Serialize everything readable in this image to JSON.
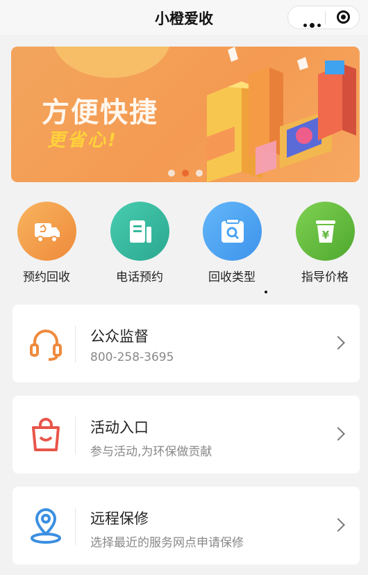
{
  "header": {
    "title": "小橙爱收"
  },
  "banner": {
    "headline": "方便快捷",
    "subline": "更省心!",
    "slides": 3,
    "active_slide": 2
  },
  "menu": {
    "items": [
      {
        "label": "预约回收",
        "icon": "truck-icon",
        "color": "#f29a46"
      },
      {
        "label": "电话预约",
        "icon": "phone-document-icon",
        "color": "#35b89d"
      },
      {
        "label": "回收类型",
        "icon": "search-box-icon",
        "color": "#4aa3f2"
      },
      {
        "label": "指导价格",
        "icon": "yen-bin-icon",
        "color": "#5fb83b"
      }
    ]
  },
  "cards": [
    {
      "title": "公众监督",
      "subtitle": "800-258-3695",
      "icon": "headset-icon",
      "icon_color": "#ef8a3c"
    },
    {
      "title": "活动入口",
      "subtitle": "参与活动,为环保做贡献",
      "icon": "shopping-bag-icon",
      "icon_color": "#e8554a"
    },
    {
      "title": "远程保修",
      "subtitle": "选择最近的服务网点申请保修",
      "icon": "location-pin-icon",
      "icon_color": "#3b8fe0"
    }
  ]
}
